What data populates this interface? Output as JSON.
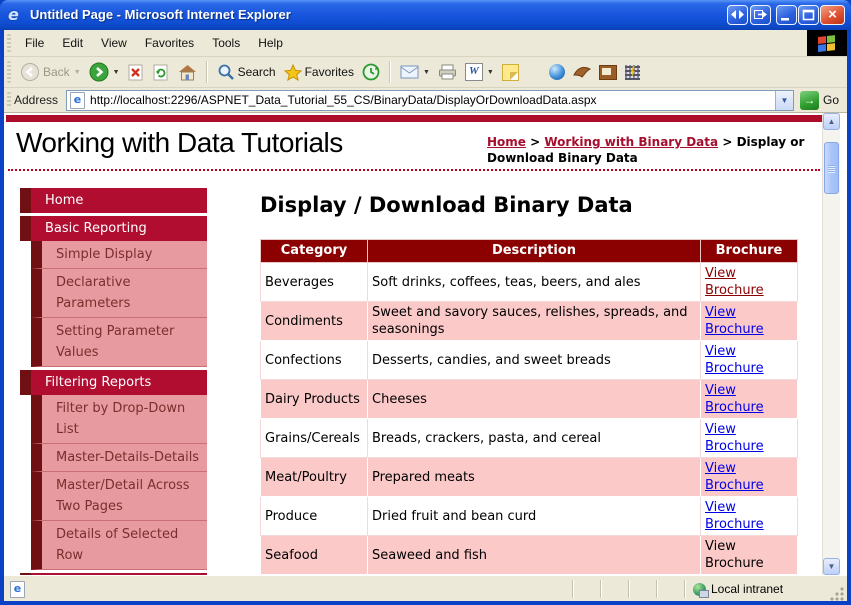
{
  "window": {
    "title": "Untitled Page - Microsoft Internet Explorer"
  },
  "menu": {
    "items": [
      "File",
      "Edit",
      "View",
      "Favorites",
      "Tools",
      "Help"
    ]
  },
  "toolbar": {
    "back_label": "Back",
    "search_label": "Search",
    "favorites_label": "Favorites"
  },
  "address": {
    "label": "Address",
    "url": "http://localhost:2296/ASPNET_Data_Tutorial_55_CS/BinaryData/DisplayOrDownloadData.aspx",
    "go_label": "Go"
  },
  "page": {
    "site_title": "Working with Data Tutorials",
    "breadcrumb": {
      "home": "Home",
      "sep": ">",
      "section": "Working with Binary Data",
      "current": "Display or Download Binary Data"
    },
    "heading": "Display / Download Binary Data"
  },
  "sidebar": {
    "items": [
      "Home",
      "Basic Reporting",
      "Simple Display",
      "Declarative Parameters",
      "Setting Parameter Values",
      "Filtering Reports",
      "Filter by Drop-Down List",
      "Master-Details-Details",
      "Master/Detail Across Two Pages",
      "Details of Selected Row"
    ]
  },
  "table": {
    "headers": [
      "Category",
      "Description",
      "Brochure"
    ],
    "rows": [
      {
        "category": "Beverages",
        "description": "Soft drinks, coffees, teas, beers, and ales",
        "brochure": "View Brochure"
      },
      {
        "category": "Condiments",
        "description": "Sweet and savory sauces, relishes, spreads, and seasonings",
        "brochure": "View Brochure"
      },
      {
        "category": "Confections",
        "description": "Desserts, candies, and sweet breads",
        "brochure": "View Brochure"
      },
      {
        "category": "Dairy Products",
        "description": "Cheeses",
        "brochure": "View Brochure"
      },
      {
        "category": "Grains/Cereals",
        "description": "Breads, crackers, pasta, and cereal",
        "brochure": "View Brochure"
      },
      {
        "category": "Meat/Poultry",
        "description": "Prepared meats",
        "brochure": "View Brochure"
      },
      {
        "category": "Produce",
        "description": "Dried fruit and bean curd",
        "brochure": "View Brochure"
      },
      {
        "category": "Seafood",
        "description": "Seaweed and fish",
        "brochure": "View Brochure"
      }
    ]
  },
  "statusbar": {
    "zone": "Local intranet"
  },
  "colors": {
    "crimson": "#ab0d2b",
    "dark_maroon": "#701014",
    "sub_item_pink": "#e79ba0",
    "table_header": "#8b0000",
    "row_pink": "#fcc9c9",
    "link_blue": "#0000e6",
    "visited_link": "#8b0000",
    "xp_beige": "#ece9d8",
    "titlebar_blue": "#1a57de"
  }
}
